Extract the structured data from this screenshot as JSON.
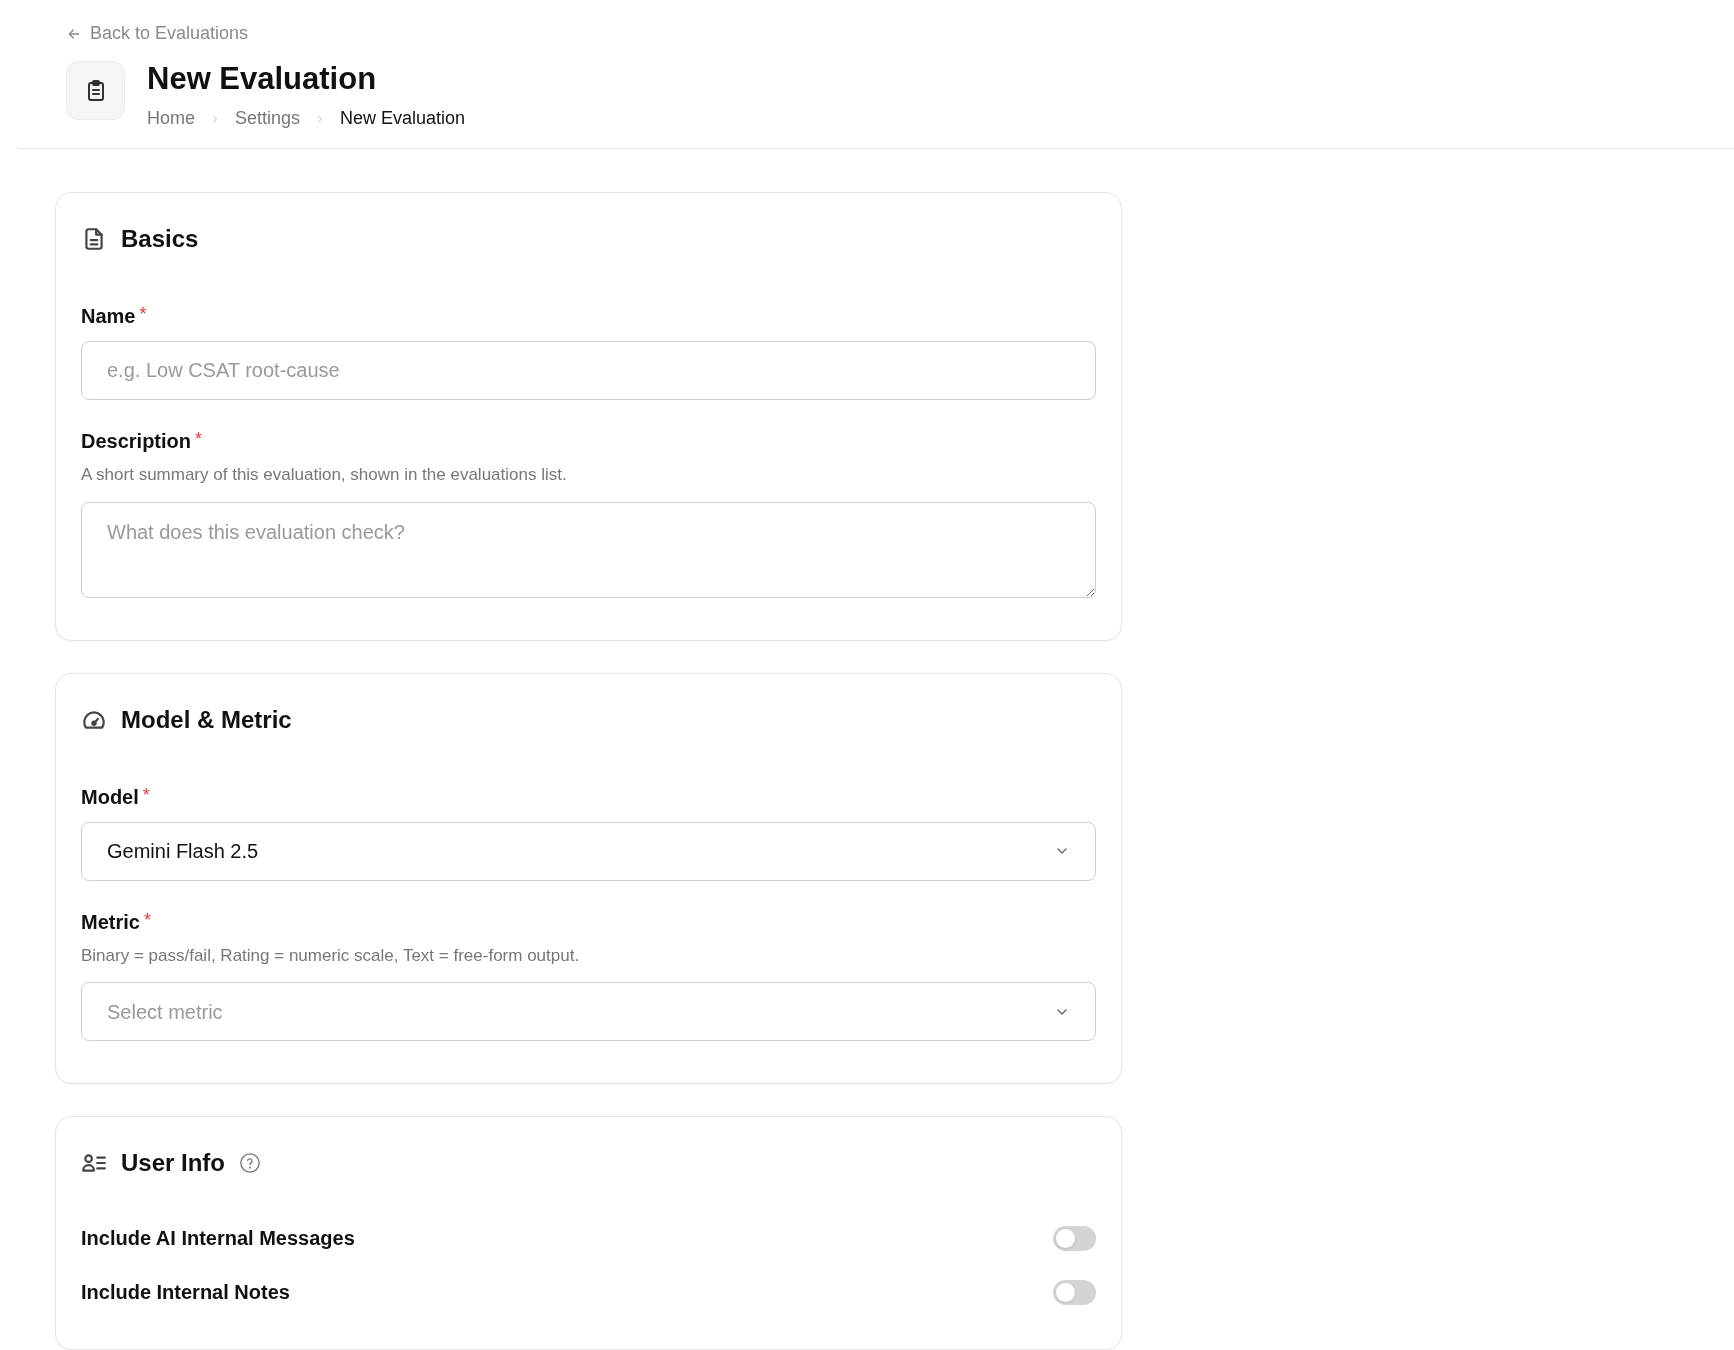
{
  "back_link": {
    "label": "Back to Evaluations"
  },
  "header": {
    "title": "New Evaluation",
    "breadcrumbs": [
      {
        "label": "Home",
        "current": false
      },
      {
        "label": "Settings",
        "current": false
      },
      {
        "label": "New Evaluation",
        "current": true
      }
    ]
  },
  "sections": [
    {
      "kind": "basics",
      "title": "Basics",
      "fields": [
        {
          "kind": "input",
          "label": "Name",
          "required_mark": "*",
          "placeholder": "e.g. Low CSAT root-cause"
        },
        {
          "kind": "textarea",
          "label": "Description",
          "required_mark": "*",
          "hint": "A short summary of this evaluation, shown in the evaluations list.",
          "placeholder": "What does this evaluation check?"
        }
      ]
    },
    {
      "kind": "model",
      "title": "Model & Metric",
      "fields": [
        {
          "kind": "select",
          "label": "Model",
          "required_mark": "*",
          "value": "Gemini Flash 2.5"
        },
        {
          "kind": "select",
          "label": "Metric",
          "required_mark": "*",
          "hint": "Binary = pass/fail, Rating = numeric scale, Text = free-form output.",
          "placeholder": "Select metric"
        }
      ]
    },
    {
      "kind": "user",
      "title": "User Info",
      "help": true,
      "fields": [
        {
          "kind": "toggle",
          "label": "Include AI Internal Messages",
          "on": false
        },
        {
          "kind": "toggle",
          "label": "Include Internal Notes",
          "on": false
        }
      ]
    }
  ]
}
